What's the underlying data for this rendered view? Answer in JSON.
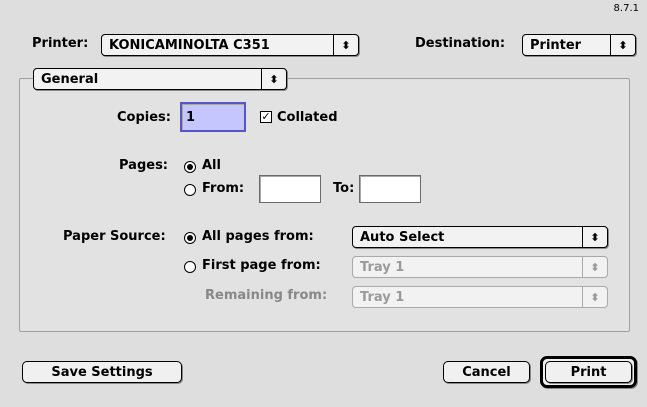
{
  "version": "8.7.1",
  "printer": {
    "label": "Printer:",
    "value": "KONICAMINOLTA C351"
  },
  "destination": {
    "label": "Destination:",
    "value": "Printer"
  },
  "section_popup": {
    "value": "General"
  },
  "copies": {
    "label": "Copies:",
    "value": "1",
    "collated_label": "Collated",
    "collated_checked": true
  },
  "pages": {
    "label": "Pages:",
    "all_label": "All",
    "from_label": "From:",
    "to_label": "To:",
    "from_value": "",
    "to_value": "",
    "selected": "All"
  },
  "paper_source": {
    "label": "Paper Source:",
    "all_pages_label": "All pages from:",
    "all_pages_value": "Auto Select",
    "first_page_label": "First page from:",
    "first_page_value": "Tray 1",
    "remaining_label": "Remaining from:",
    "remaining_value": "Tray 1",
    "selected": "All pages from"
  },
  "buttons": {
    "save_settings": "Save Settings",
    "cancel": "Cancel",
    "print": "Print"
  },
  "icons": {
    "popup_arrows": "up-down-arrows-icon",
    "check": "checkmark-icon"
  }
}
